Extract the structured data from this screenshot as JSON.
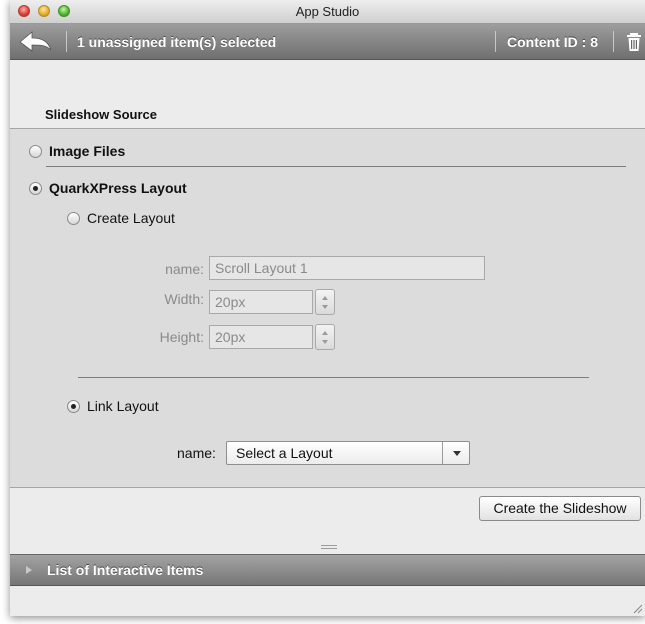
{
  "window": {
    "title": "App Studio"
  },
  "toolbar": {
    "selection_text": "1 unassigned item(s) selected",
    "content_id_text": "Content ID : 8",
    "icons": {
      "back": "back-arrow-icon",
      "trash": "trash-icon"
    }
  },
  "section_title": "Slideshow Source",
  "options": {
    "image_files": {
      "label": "Image Files",
      "selected": false
    },
    "quarkxpress_layout": {
      "label": "QuarkXPress Layout",
      "selected": true
    }
  },
  "create_layout": {
    "label": "Create Layout",
    "selected": false,
    "fields": {
      "name_label": "name:",
      "name_value": "Scroll Layout 1",
      "width_label": "Width:",
      "width_value": "20px",
      "height_label": "Height:",
      "height_value": "20px"
    }
  },
  "link_layout": {
    "label": "Link Layout",
    "selected": true,
    "name_label": "name:",
    "select_value": "Select a Layout"
  },
  "create_button": "Create the Slideshow",
  "list_panel": {
    "title": "List of Interactive Items"
  }
}
